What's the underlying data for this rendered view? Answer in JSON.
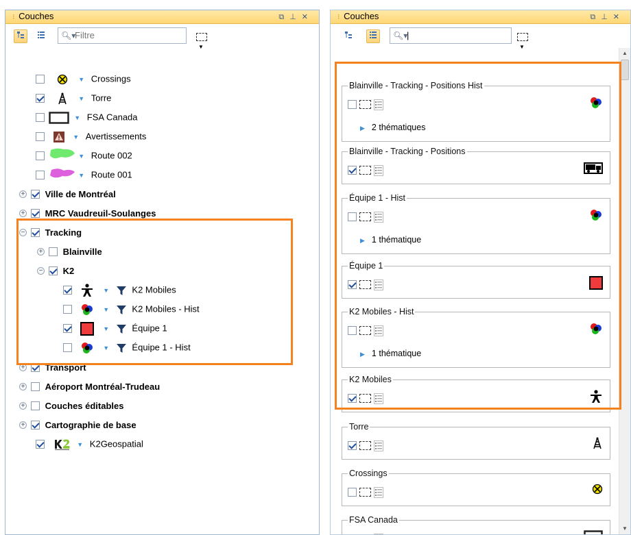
{
  "left_panel": {
    "title": "Couches",
    "search_placeholder": "Filtre",
    "tree": [
      {
        "label": "Crossings",
        "checked": false,
        "symbol": "crossing-icon"
      },
      {
        "label": "Torre",
        "checked": true,
        "symbol": "tower-icon"
      },
      {
        "label": "FSA Canada",
        "checked": false,
        "symbol": "rectangle-outline-icon"
      },
      {
        "label": "Avertissements",
        "checked": false,
        "symbol": "warning-icon"
      },
      {
        "label": "Route 002",
        "checked": false,
        "symbol": "green-area-icon"
      },
      {
        "label": "Route 001",
        "checked": false,
        "symbol": "pink-area-icon"
      },
      {
        "label": "Ville de Montréal",
        "checked": true
      },
      {
        "label": "MRC Vaudreuil-Soulanges",
        "checked": true
      },
      {
        "label": "Tracking",
        "checked": true
      },
      {
        "label": "Blainville",
        "checked": false
      },
      {
        "label": "K2",
        "checked": true
      },
      {
        "label": "K2 Mobiles",
        "checked": true,
        "symbol": "person-icon"
      },
      {
        "label": "K2 Mobiles - Hist",
        "checked": false,
        "symbol": "tricolor-dots-icon"
      },
      {
        "label": "Équipe 1",
        "checked": true,
        "symbol": "red-square-icon"
      },
      {
        "label": "Équipe 1 - Hist",
        "checked": false,
        "symbol": "tricolor-dots-icon"
      },
      {
        "label": "Transport",
        "checked": true
      },
      {
        "label": "Aéroport Montréal-Trudeau",
        "checked": false
      },
      {
        "label": "Couches éditables",
        "checked": false
      },
      {
        "label": "Cartographie de base",
        "checked": true
      },
      {
        "label": "K2Geospatial",
        "checked": true,
        "symbol": "k2-logo-icon"
      }
    ]
  },
  "right_panel": {
    "title": "Couches",
    "search_value": "",
    "cards": [
      {
        "title": "Blainville - Tracking - Positions Hist",
        "checked": false,
        "thematic": "2 thématiques",
        "icon": "tricolor-dots-icon"
      },
      {
        "title": "Blainville - Tracking - Positions",
        "checked": true,
        "thematic": "",
        "icon": "truck-icon"
      },
      {
        "title": "Équipe 1 - Hist",
        "checked": false,
        "thematic": "1 thématique",
        "icon": "tricolor-dots-icon"
      },
      {
        "title": "Équipe 1",
        "checked": true,
        "thematic": "",
        "icon": "red-square-icon"
      },
      {
        "title": "K2 Mobiles - Hist",
        "checked": false,
        "thematic": "1 thématique",
        "icon": "tricolor-dots-icon"
      },
      {
        "title": "K2 Mobiles",
        "checked": true,
        "thematic": "",
        "icon": "person-icon"
      },
      {
        "title": "Torre",
        "checked": true,
        "thematic": "",
        "icon": "tower-icon"
      },
      {
        "title": "Crossings",
        "checked": false,
        "thematic": "",
        "icon": "crossing-icon"
      },
      {
        "title": "FSA Canada",
        "checked": false,
        "thematic": "",
        "icon": "rectangle-outline-icon"
      }
    ]
  },
  "colors": {
    "highlight": "#f5821f",
    "titlebar": "#ffd774",
    "accent": "#3c8fd8"
  }
}
